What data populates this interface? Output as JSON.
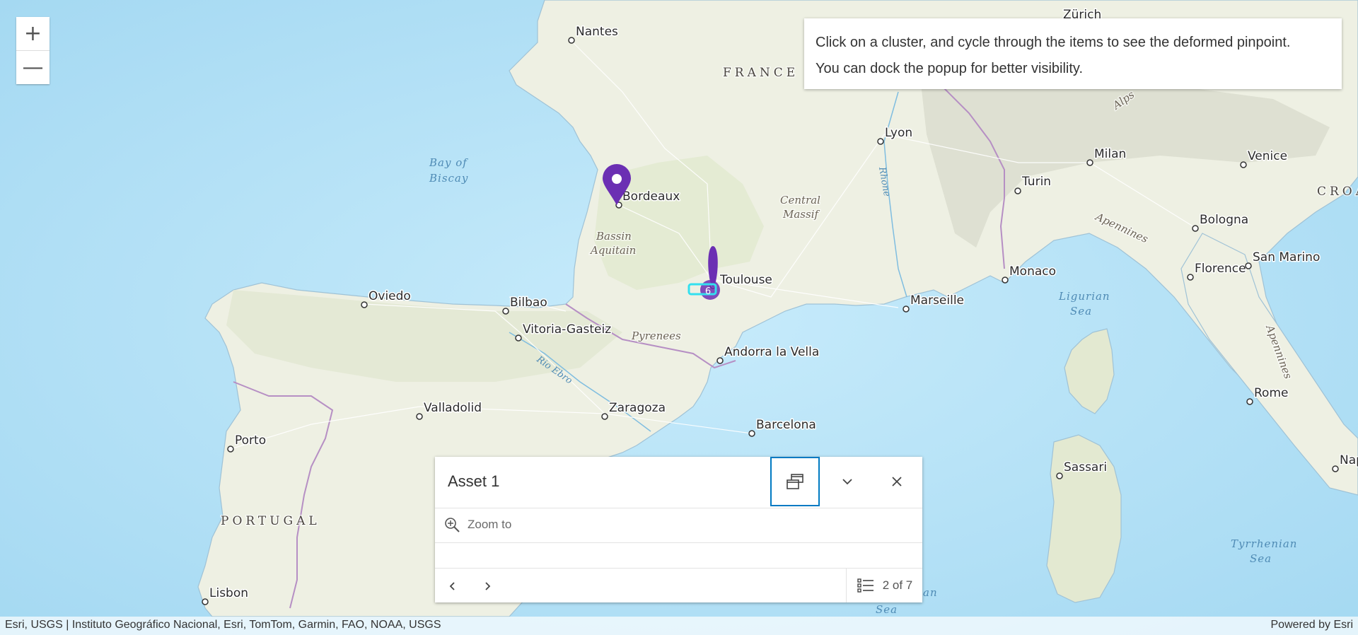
{
  "map": {
    "countries": [
      "FRANCE",
      "PORTUGAL",
      "CROA"
    ],
    "water": {
      "bay_line1": "Bay of",
      "bay_line2": "Biscay",
      "ligurian_line1": "Ligurian",
      "ligurian_line2": "Sea",
      "tyrrhenian_line1": "Tyrrhenian",
      "tyrrhenian_line2": "Sea",
      "sea_fragment": "Sea",
      "an_fragment": "an"
    },
    "regions": {
      "bassin_line1": "Bassin",
      "bassin_line2": "Aquitain",
      "central_line1": "Central",
      "central_line2": "Massif",
      "pyrenees": "Pyrenees",
      "alps": "Alps",
      "apennines": "Apennines"
    },
    "rivers": {
      "rhone": "Rhone",
      "ebro": "Rio Ebro"
    },
    "cities": [
      "Nantes",
      "Lyon",
      "Bordeaux",
      "Milan",
      "Venice",
      "Turin",
      "Bologna",
      "Toulouse",
      "Monaco",
      "Florence",
      "San Marino",
      "Marseille",
      "Oviedo",
      "Bilbao",
      "Vitoria-Gasteiz",
      "Andorra la Vella",
      "Valladolid",
      "Zaragoza",
      "Barcelona",
      "Rome",
      "Porto",
      "Sassari",
      "Lisbon",
      "Zürich",
      "Nap"
    ],
    "cluster_count": "6",
    "marker_color": "#6b2fb3",
    "cluster_highlight_color": "#33e0ef"
  },
  "zoom": {
    "in_label": "+",
    "out_label": "—"
  },
  "hint": {
    "line1": "Click on a cluster, and cycle through the items to see the deformed pinpoint.",
    "line2": "You can dock the popup for better visibility."
  },
  "popup": {
    "title": "Asset 1",
    "zoom_to_label": "Zoom to",
    "pagination": "2 of 7",
    "dock_icon": "dock-icon",
    "collapse_icon": "chevron-down-icon",
    "close_icon": "close-icon",
    "prev_icon": "chevron-left-icon",
    "next_icon": "chevron-right-icon",
    "list_icon": "list-icon",
    "accent_color": "#007ac2"
  },
  "attribution": {
    "sources": "Esri, USGS | Instituto Geográfico Nacional, Esri, TomTom, Garmin, FAO, NOAA, USGS",
    "powered_by": "Powered by Esri"
  }
}
